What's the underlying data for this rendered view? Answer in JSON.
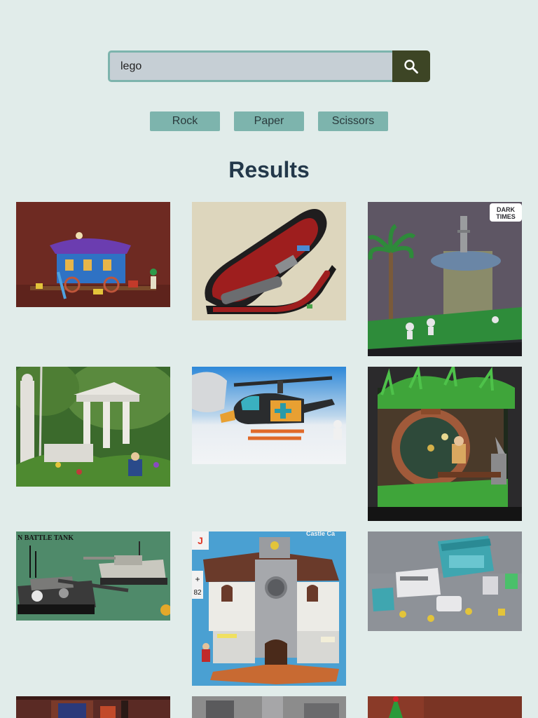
{
  "search": {
    "value": "lego",
    "icon": "search-icon"
  },
  "filters": [
    "Rock",
    "Paper",
    "Scissors"
  ],
  "results": {
    "title": "Results",
    "images": [
      {
        "subject": "purple-roof blue caravan wagon with minifigures",
        "bg": "#6e2a22"
      },
      {
        "subject": "open instrument case with red lining and machine gun",
        "bg": "#ddd6bd"
      },
      {
        "subject": "round hut with palm tree and stormtroopers",
        "bg": "#5e5664",
        "caption": "DARK TIMES RPG"
      },
      {
        "subject": "white greek temple ruins in green forest",
        "bg": "#3b6a2c"
      },
      {
        "subject": "orange blue helicopter in snow",
        "bg": "#2e88d8"
      },
      {
        "subject": "hobbit hole round door with wizard",
        "bg": "#2b2a2c"
      },
      {
        "subject": "camouflage battle tanks",
        "bg": "#4f8a6a",
        "caption": "N BATTLE TANK"
      },
      {
        "subject": "tall gray castle with clock tower",
        "bg": "#4aa0d2",
        "caption": "Castle"
      },
      {
        "subject": "teal industrial machinery with figures",
        "bg": "#8e9298"
      },
      {
        "subject": "timber building with red roof",
        "bg": "#5a2a24"
      },
      {
        "subject": "gray stone castle wall",
        "bg": "#8c8c8c"
      },
      {
        "subject": "green christmas tree",
        "bg": "#8a3a28"
      }
    ]
  }
}
